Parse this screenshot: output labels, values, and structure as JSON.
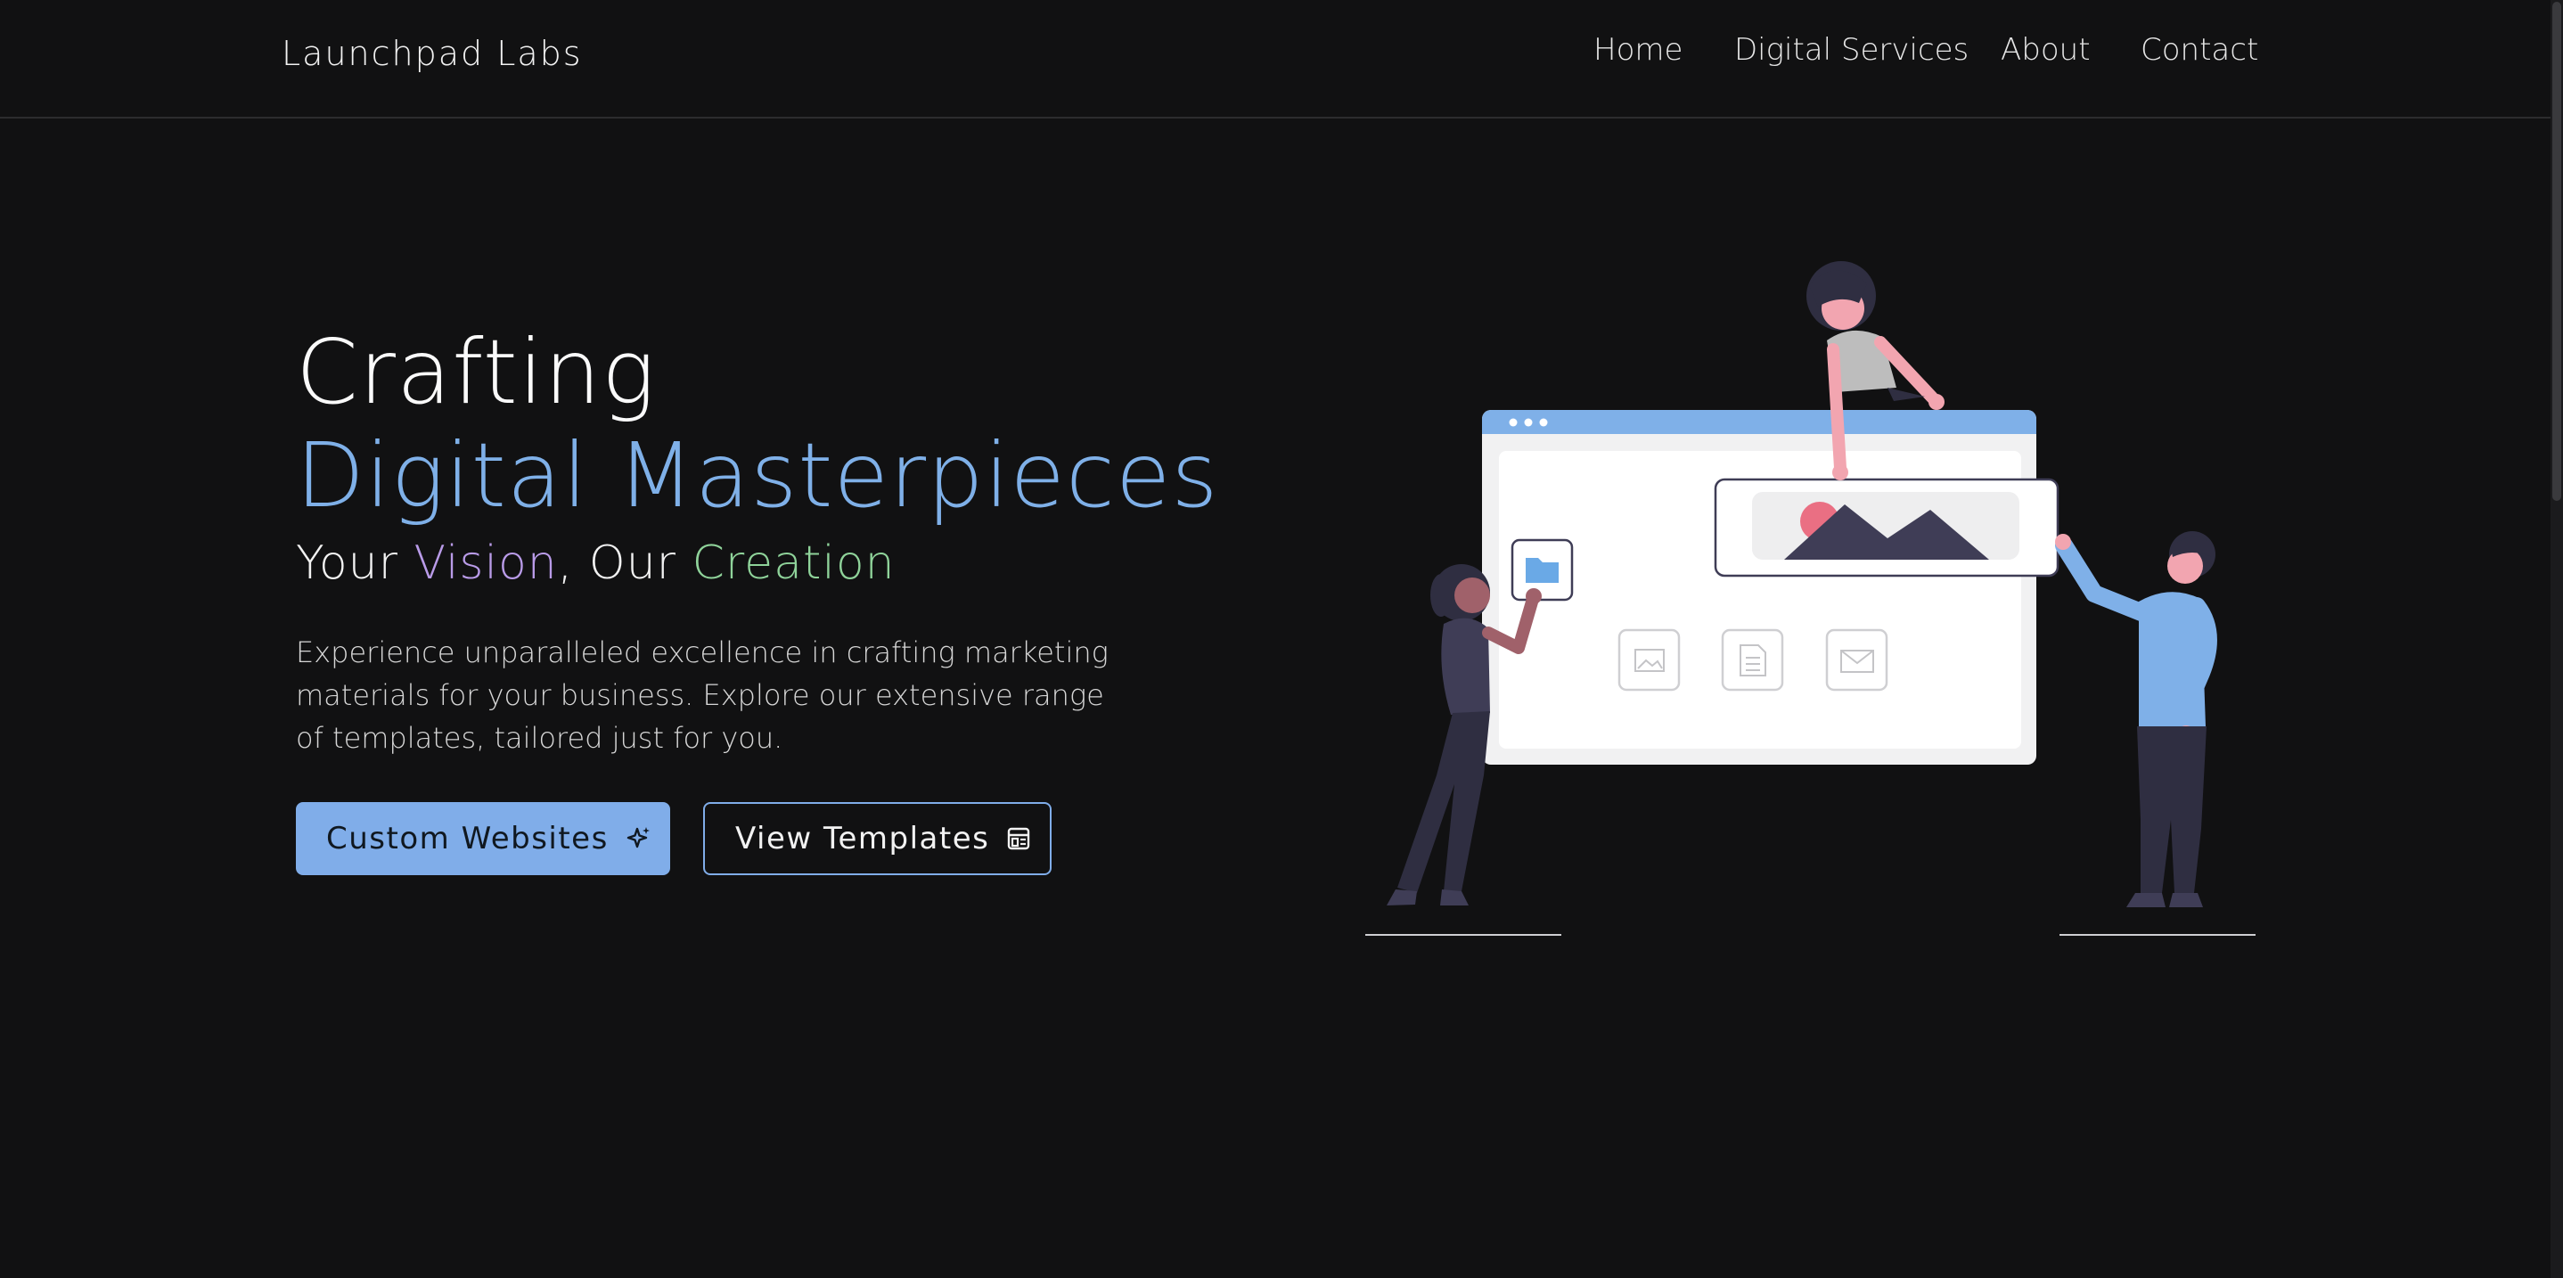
{
  "nav": {
    "brand": "Launchpad Labs",
    "links": [
      "Home",
      "Digital Services",
      "About",
      "Contact"
    ]
  },
  "hero": {
    "title_line1": "Crafting",
    "title_line2": "Digital Masterpieces",
    "tagline": {
      "part1": "Your ",
      "vision": "Vision",
      "part2": ", Our ",
      "creation": "Creation"
    },
    "description": "Experience unparalleled excellence in crafting marketing materials for your business. Explore our extensive range of templates, tailored just for you.",
    "buttons": {
      "primary_label": "Custom Websites",
      "secondary_label": "View Templates"
    }
  },
  "icons": {
    "primary_button_icon": "sparkle-icon",
    "secondary_button_icon": "template-layout-icon",
    "illustration_icons": [
      "folder-icon",
      "image-icon",
      "document-icon",
      "mail-icon"
    ]
  },
  "colors": {
    "background": "#111112",
    "accent_blue": "#80ade9",
    "vision_purple": "#b99be8",
    "creation_green": "#8fd39a",
    "illustration_pink": "#f2a5b0"
  }
}
